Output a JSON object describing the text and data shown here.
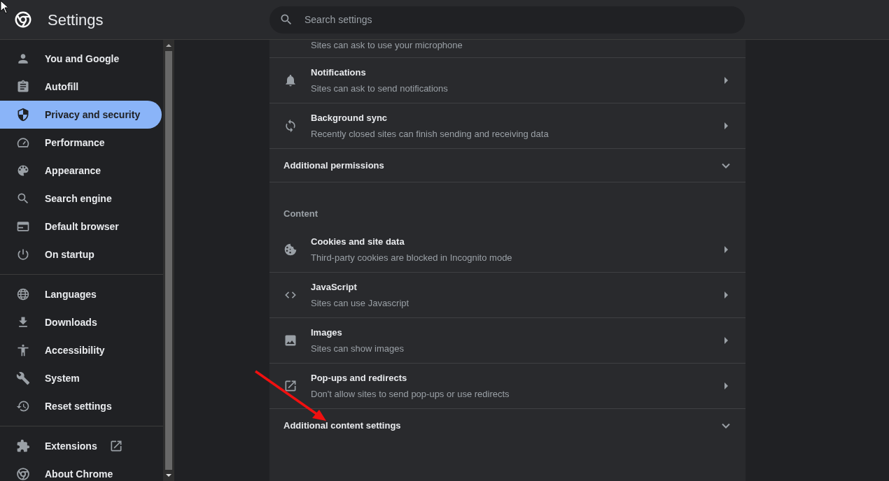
{
  "header": {
    "title": "Settings",
    "search": {
      "placeholder": "Search settings"
    }
  },
  "sidebar": {
    "groups": [
      {
        "items": [
          {
            "label": "You and Google",
            "selected": false,
            "kind": "page"
          },
          {
            "label": "Autofill",
            "selected": false,
            "kind": "page"
          },
          {
            "label": "Privacy and security",
            "selected": true,
            "kind": "page"
          },
          {
            "label": "Performance",
            "selected": false,
            "kind": "page"
          },
          {
            "label": "Appearance",
            "selected": false,
            "kind": "page"
          },
          {
            "label": "Search engine",
            "selected": false,
            "kind": "page"
          },
          {
            "label": "Default browser",
            "selected": false,
            "kind": "page"
          },
          {
            "label": "On startup",
            "selected": false,
            "kind": "page"
          }
        ]
      },
      {
        "items": [
          {
            "label": "Languages",
            "selected": false,
            "kind": "page"
          },
          {
            "label": "Downloads",
            "selected": false,
            "kind": "page"
          },
          {
            "label": "Accessibility",
            "selected": false,
            "kind": "page"
          },
          {
            "label": "System",
            "selected": false,
            "kind": "page"
          },
          {
            "label": "Reset settings",
            "selected": false,
            "kind": "page"
          }
        ]
      },
      {
        "items": [
          {
            "label": "Extensions",
            "selected": false,
            "kind": "external"
          },
          {
            "label": "About Chrome",
            "selected": false,
            "kind": "page"
          }
        ]
      }
    ]
  },
  "content": {
    "items": [
      {
        "kind": "cut_row",
        "subtitle": "Sites can ask to use your microphone"
      },
      {
        "kind": "link_row",
        "title": "Notifications",
        "subtitle": "Sites can ask to send notifications"
      },
      {
        "kind": "link_row",
        "title": "Background sync",
        "subtitle": "Recently closed sites can finish sending and receiving data"
      },
      {
        "kind": "expander",
        "title": "Additional permissions",
        "expanded": false
      },
      {
        "kind": "heading",
        "title": "Content"
      },
      {
        "kind": "link_row",
        "title": "Cookies and site data",
        "subtitle": "Third-party cookies are blocked in Incognito mode"
      },
      {
        "kind": "link_row",
        "title": "JavaScript",
        "subtitle": "Sites can use Javascript"
      },
      {
        "kind": "link_row",
        "title": "Images",
        "subtitle": "Sites can show images"
      },
      {
        "kind": "link_row",
        "title": "Pop-ups and redirects",
        "subtitle": "Don't allow sites to send pop-ups or use redirects"
      },
      {
        "kind": "expander",
        "title": "Additional content settings",
        "expanded": false
      }
    ]
  }
}
